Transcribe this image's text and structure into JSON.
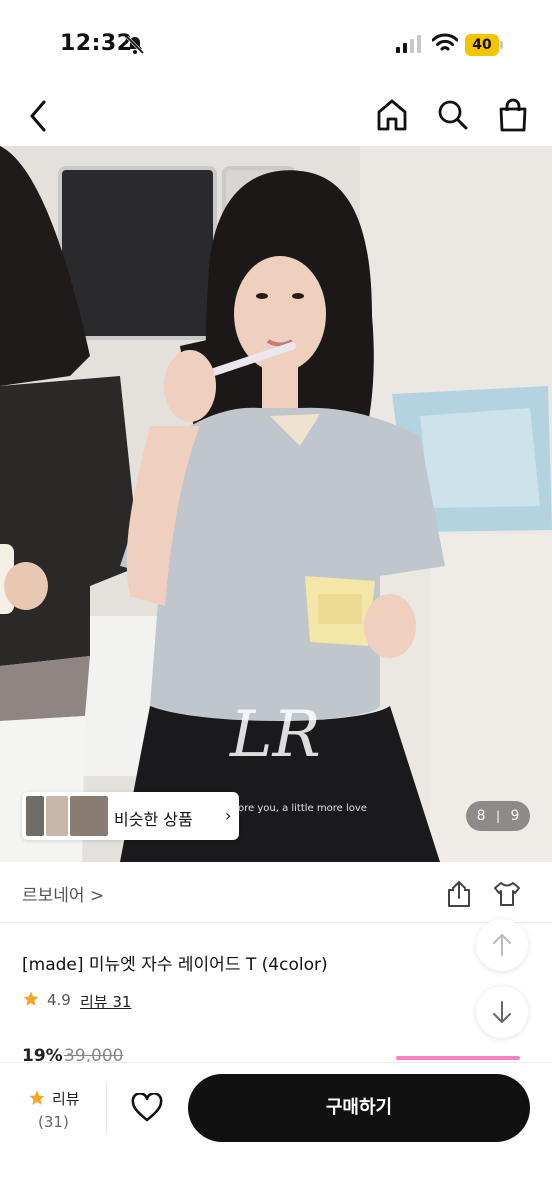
{
  "status_bar": {
    "time": "12:32",
    "battery": "40",
    "icons": [
      "bell-slash-icon",
      "signal-icon",
      "wifi-icon",
      "battery-icon"
    ]
  },
  "nav": {
    "icons": [
      "back-icon",
      "home-icon",
      "search-icon",
      "shopping-bag-icon"
    ]
  },
  "hero": {
    "similar_label": "비슷한 상품",
    "watermark_text": "ore you, a little more love",
    "pager": {
      "current": "8",
      "separator": "|",
      "total": "9"
    },
    "logo_text": "LR"
  },
  "brand": {
    "name": "르보네어 >"
  },
  "product": {
    "title": "[made] 미뉴엣 자수 레이어드 T (4color)",
    "rating": "4.9",
    "review_link": "리뷰 31",
    "discount": "19%",
    "original_price": "39,000"
  },
  "bottom_bar": {
    "review_label": "리뷰",
    "review_count": "(31)",
    "buy_label": "구매하기"
  },
  "colors": {
    "star": "#f5a623",
    "buy_button": "#111111",
    "accent_pink": "#ff7fc6",
    "battery": "#f5c400"
  }
}
